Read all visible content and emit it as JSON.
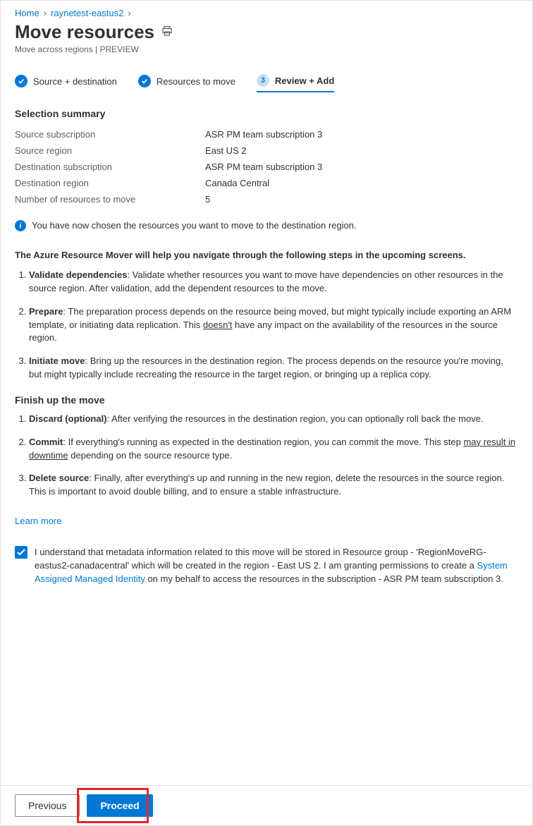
{
  "breadcrumb": {
    "home": "Home",
    "rg": "raynetest-eastus2"
  },
  "title": "Move resources",
  "subtitle": "Move across regions | PREVIEW",
  "steps": {
    "s1": "Source + destination",
    "s2": "Resources to move",
    "s3_num": "3",
    "s3": "Review + Add"
  },
  "summary": {
    "title": "Selection summary",
    "rows": {
      "src_sub_l": "Source subscription",
      "src_sub_v": "ASR PM team subscription 3",
      "src_reg_l": "Source region",
      "src_reg_v": "East US 2",
      "dst_sub_l": "Destination subscription",
      "dst_sub_v": "ASR PM team subscription 3",
      "dst_reg_l": "Destination region",
      "dst_reg_v": "Canada Central",
      "count_l": "Number of resources to move",
      "count_v": "5"
    }
  },
  "info_msg": "You have now chosen the resources you want to move to the destination region.",
  "intro": "The Azure Resource Mover will help you navigate through the following steps in the upcoming screens.",
  "ol1": {
    "i1_b": "Validate dependencies",
    "i1_t": ": Validate whether resources you want to move have dependencies on other resources in the source region. After validation, add the dependent resources to the move.",
    "i2_b": "Prepare",
    "i2_t1": ": The preparation process depends on the resource being moved, but might typically include exporting an ARM template, or initiating data replication. This ",
    "i2_u": "doesn't",
    "i2_t2": " have any impact on the availability of the resources in the source region.",
    "i3_b": "Initiate move",
    "i3_t": ": Bring up the resources in the destination region. The process depends on the resource you're moving, but might typically include recreating the resource in the target region, or bringing up a replica copy."
  },
  "finish_title": "Finish up the move",
  "ol2": {
    "i1_b": "Discard (optional)",
    "i1_t": ": After verifying the resources in the destination region, you can optionally roll back the move.",
    "i2_b": "Commit",
    "i2_t1": ": If everything's running as expected in the destination region, you can commit the move. This step ",
    "i2_u": "may result in downtime",
    "i2_t2": " depending on the source resource type.",
    "i3_b": "Delete source",
    "i3_t": ": Finally, after everything's up and running in the new region, delete the resources in the source region. This is important to avoid double billing, and to ensure a stable infrastructure."
  },
  "learn_more": "Learn more",
  "consent": {
    "t1": "I understand that metadata information related to this move will be stored in Resource group - 'RegionMoveRG-eastus2-canadacentral' which will be created in the region - East US 2. I am granting permissions to create a ",
    "link": "System Assigned Managed Identity",
    "t2": " on my behalf to access the resources in the subscription - ASR PM team subscription 3."
  },
  "buttons": {
    "prev": "Previous",
    "proceed": "Proceed"
  }
}
